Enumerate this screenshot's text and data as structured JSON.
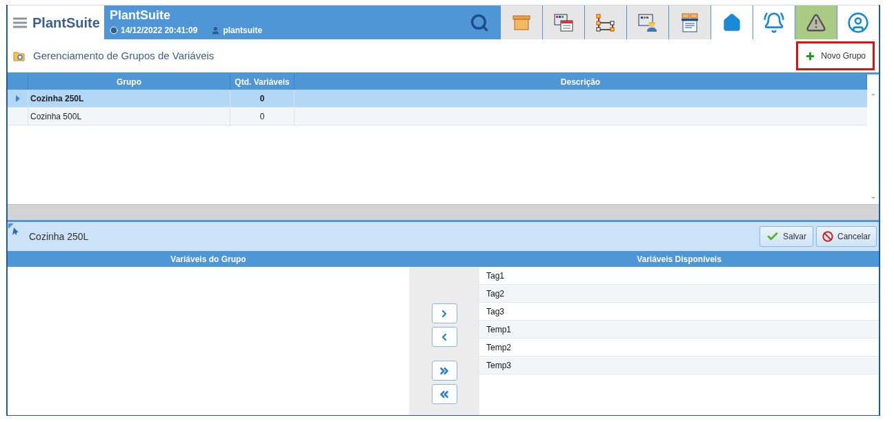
{
  "header": {
    "logo": "PlantSuite",
    "title": "PlantSuite",
    "datetime": "14/12/2022 20:41:09",
    "user": "plantsuite",
    "toolbar": [
      {
        "kind": "box",
        "highlighted": false
      },
      {
        "kind": "calendar",
        "highlighted": false
      },
      {
        "kind": "diagram",
        "highlighted": false
      },
      {
        "kind": "operator",
        "highlighted": false
      },
      {
        "kind": "report",
        "highlighted": false
      },
      {
        "kind": "home",
        "highlighted": false
      },
      {
        "kind": "bell",
        "highlighted": false
      },
      {
        "kind": "warning",
        "highlighted": true
      },
      {
        "kind": "user",
        "highlighted": false
      }
    ]
  },
  "page": {
    "title": "Gerenciamento de Grupos de Variáveis",
    "new_button": "Novo Grupo"
  },
  "groups_table": {
    "columns": [
      "Grupo",
      "Qtd. Variáveis",
      "Descrição"
    ],
    "rows": [
      {
        "grupo": "Cozinha 250L",
        "qtd": "0",
        "selected": true
      },
      {
        "grupo": "Cozinha 500L",
        "qtd": "0",
        "selected": false
      }
    ]
  },
  "detail": {
    "title": "Cozinha 250L",
    "save": "Salvar",
    "cancel": "Cancelar",
    "group_vars_header": "Variáveis do Grupo",
    "available_header": "Variáveis Disponíveis",
    "available": [
      "Tag1",
      "Tag2",
      "Tag3",
      "Temp1",
      "Temp2",
      "Temp3"
    ]
  }
}
